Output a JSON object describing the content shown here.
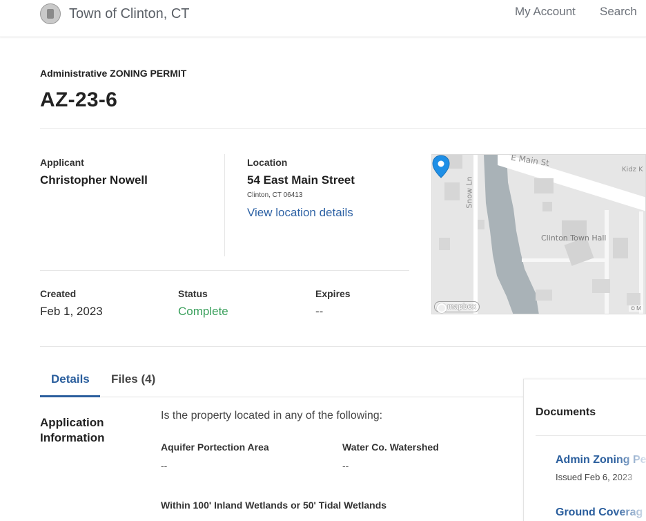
{
  "header": {
    "town_name": "Town of Clinton, CT",
    "nav": {
      "my_account": "My Account",
      "search": "Search"
    }
  },
  "permit": {
    "type_label": "Administrative ZONING PERMIT",
    "id": "AZ-23-6"
  },
  "summary": {
    "applicant_label": "Applicant",
    "applicant": "Christopher Nowell",
    "location_label": "Location",
    "address": "54 East Main Street",
    "city": "Clinton, CT 06413",
    "location_link": "View location details",
    "created_label": "Created",
    "created": "Feb 1, 2023",
    "status_label": "Status",
    "status": "Complete",
    "expires_label": "Expires",
    "expires": "--"
  },
  "map": {
    "street_main": "E Main St",
    "street_snow": "Snow Ln",
    "poi_kidz": "Kidz K",
    "poi_hall": "Clinton Town Hall",
    "attribution_logo": "mapbox",
    "copyright": "© M"
  },
  "tabs": [
    {
      "label": "Details",
      "active": true
    },
    {
      "label": "Files (4)",
      "active": false
    }
  ],
  "application": {
    "section_title": "Application Information",
    "question": "Is the property located in any of the following:",
    "fields": [
      {
        "label": "Aquifer Portection Area",
        "value": "--"
      },
      {
        "label": "Water Co. Watershed",
        "value": "--"
      },
      {
        "label": "Within 100' Inland Wetlands or 50' Tidal Wetlands",
        "value": ""
      }
    ]
  },
  "documents": {
    "title": "Documents",
    "items": [
      {
        "name": "Admin Zoning Pe",
        "sub": "Issued Feb 6, 2023"
      },
      {
        "name": "Ground Coverag",
        "sub": ""
      }
    ]
  },
  "colors": {
    "link": "#2f63a5",
    "tab_active": "#2a5e9d",
    "status_complete": "#3aa05c",
    "map_pin": "#1f8fe6"
  }
}
